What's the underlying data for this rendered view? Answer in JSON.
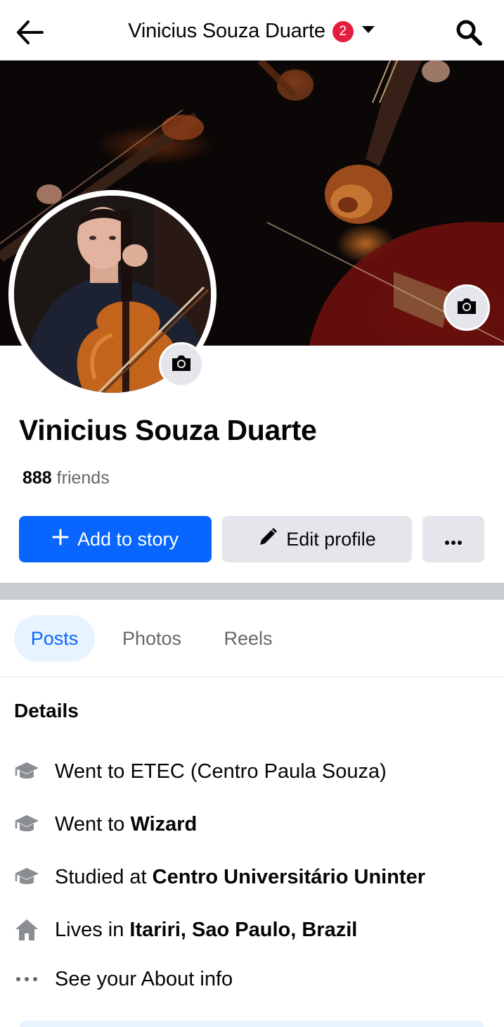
{
  "header": {
    "title": "Vinicius Souza Duarte",
    "notification_count": "2"
  },
  "profile": {
    "name": "Vinicius Souza Duarte",
    "friends_count": "888",
    "friends_label": "friends"
  },
  "actions": {
    "add_story_label": "Add to story",
    "edit_profile_label": "Edit profile",
    "more_label": "•••"
  },
  "tabs": [
    {
      "label": "Posts",
      "active": true
    },
    {
      "label": "Photos",
      "active": false
    },
    {
      "label": "Reels",
      "active": false
    }
  ],
  "details": {
    "title": "Details",
    "items": [
      {
        "icon": "education-icon",
        "prefix": "Went to ETEC (Centro Paula Souza)",
        "strong": ""
      },
      {
        "icon": "education-icon",
        "prefix": "Went to ",
        "strong": "Wizard"
      },
      {
        "icon": "education-icon",
        "prefix": "Studied at ",
        "strong": "Centro Universitário Uninter"
      },
      {
        "icon": "home-icon",
        "prefix": "Lives in ",
        "strong": "Itariri, Sao Paulo, Brazil"
      },
      {
        "icon": "more-dots-icon",
        "prefix": "See your About info",
        "strong": ""
      }
    ]
  },
  "colors": {
    "primary": "#0866ff",
    "badge": "#e41e3f",
    "secondary_button": "#e4e6eb",
    "muted_text": "#65676b"
  }
}
